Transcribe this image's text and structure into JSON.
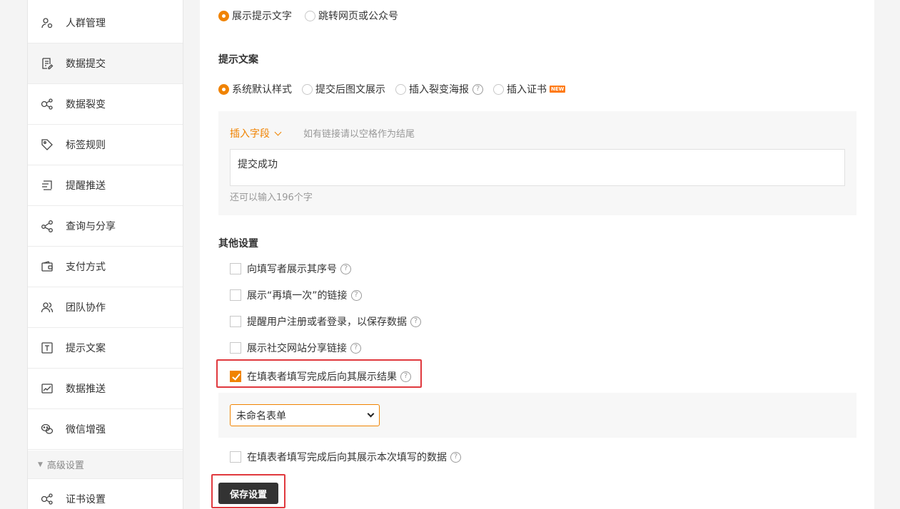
{
  "sidebar": {
    "items": [
      {
        "label": "人群管理",
        "icon": "audience-icon"
      },
      {
        "label": "数据提交",
        "icon": "document-edit-icon"
      },
      {
        "label": "数据裂变",
        "icon": "fission-icon"
      },
      {
        "label": "标签规则",
        "icon": "tag-icon"
      },
      {
        "label": "提醒推送",
        "icon": "send-icon"
      },
      {
        "label": "查询与分享",
        "icon": "share-icon"
      },
      {
        "label": "支付方式",
        "icon": "wallet-icon"
      },
      {
        "label": "团队协作",
        "icon": "team-icon"
      },
      {
        "label": "提示文案",
        "icon": "text-icon"
      },
      {
        "label": "数据推送",
        "icon": "chart-icon"
      },
      {
        "label": "微信增强",
        "icon": "wechat-icon"
      }
    ],
    "group_label": "高级设置",
    "group_items": [
      {
        "label": "证书设置",
        "icon": "certificate-icon"
      }
    ]
  },
  "after_submit": {
    "options": [
      "展示提示文字",
      "跳转网页或公众号"
    ],
    "selected": 0
  },
  "tip_copy": {
    "title": "提示文案",
    "options": [
      "系统默认样式",
      "提交后图文展示",
      "插入裂变海报",
      "插入证书"
    ],
    "selected": 0,
    "new_badge": "NEW",
    "insert_field_label": "插入字段",
    "hint": "如有链接请以空格作为结尾",
    "text_value": "提交成功",
    "counter": "还可以输入196个字"
  },
  "other_settings": {
    "title": "其他设置",
    "checkboxes": [
      {
        "label": "向填写者展示其序号",
        "checked": false
      },
      {
        "label": "展示“再填一次”的链接",
        "checked": false
      },
      {
        "label": "提醒用户注册或者登录，以保存数据",
        "checked": false
      },
      {
        "label": "展示社交网站分享链接",
        "checked": false
      },
      {
        "label": "在填表者填写完成后向其展示结果",
        "checked": true
      }
    ],
    "select_value": "未命名表单",
    "last_checkbox": {
      "label": "在填表者填写完成后向其展示本次填写的数据",
      "checked": false
    }
  },
  "save_label": "保存设置",
  "colors": {
    "accent": "#f08300",
    "highlight": "#e0393e",
    "dark_button": "#333333"
  }
}
